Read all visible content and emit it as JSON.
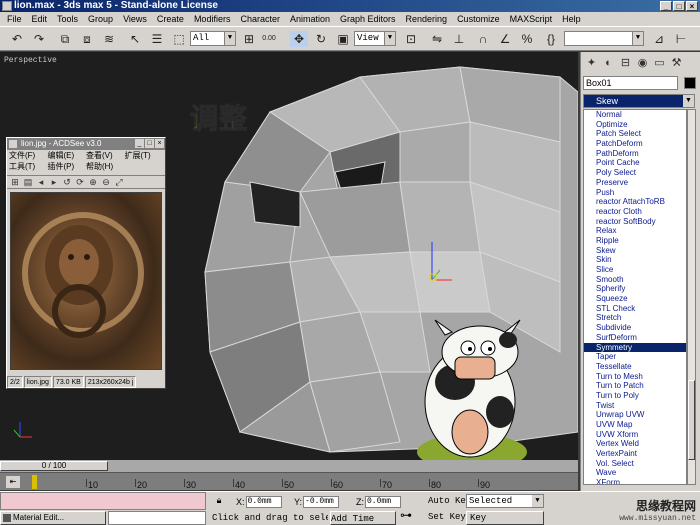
{
  "window": {
    "title": "lion.max - 3ds max 5 - Stand-alone License"
  },
  "menu": [
    "File",
    "Edit",
    "Tools",
    "Group",
    "Views",
    "Create",
    "Modifiers",
    "Character",
    "Animation",
    "Graph Editors",
    "Rendering",
    "Customize",
    "MAXScript",
    "Help"
  ],
  "toolbar": {
    "selection_filter": "All",
    "coord_system": "View",
    "number_display": "0.00",
    "named_selection": ""
  },
  "viewport": {
    "label": "Perspective",
    "overlay_text": "调整"
  },
  "acdsee": {
    "title": "lion.jpg - ACDSee v3.0",
    "menu": [
      "文件(F)",
      "编辑(E)",
      "查看(V)",
      "扩展(T)",
      "工具(T)",
      "插件(P)",
      "帮助(H)"
    ],
    "status": [
      "2/2",
      "lion.jpg",
      "73.0 KB",
      "213x260x24b j"
    ]
  },
  "command_panel": {
    "object_name": "Box01",
    "object_color": "#000000",
    "modifier_dropdown": "Skew",
    "modifiers": [
      "Normal",
      "Optimize",
      "Patch Select",
      "PatchDeform",
      "PathDeform",
      "Point Cache",
      "Poly Select",
      "Preserve",
      "Push",
      "reactor AttachToRB",
      "reactor Cloth",
      "reactor SoftBody",
      "Relax",
      "Ripple",
      "Skew",
      "Skin",
      "Slice",
      "Smooth",
      "Spherify",
      "Squeeze",
      "STL Check",
      "Stretch",
      "Subdivide",
      "SurfDeform",
      "Symmetry",
      "Taper",
      "Tessellate",
      "Turn to Mesh",
      "Turn to Patch",
      "Turn to Poly",
      "Twist",
      "Unwrap UVW",
      "UVW Map",
      "UVW Xform",
      "Vertex Weld",
      "VertexPaint",
      "Vol. Select",
      "Wave",
      "XForm"
    ],
    "selected_modifier": "Symmetry"
  },
  "timeline": {
    "slider_label": "0 / 100",
    "ticks": [
      "10",
      "20",
      "30",
      "40",
      "50",
      "60",
      "70",
      "80",
      "90"
    ]
  },
  "status": {
    "task_button": "Material Edit...",
    "x_label": "X:",
    "x_value": "0.0mm",
    "y_label": "Y:",
    "y_value": "-0.0mm",
    "z_label": "Z:",
    "z_value": "0.0mm",
    "prompt": "Click and drag to select",
    "add_time_tag": "Add Time Tag",
    "auto_key": "Auto Key",
    "set_key": "Set Key",
    "selected_dropdown": "Selected",
    "key_filters": "Key Filters..."
  },
  "watermark": {
    "line1": "思缘教程网",
    "line2": "www.missyuan.net"
  }
}
